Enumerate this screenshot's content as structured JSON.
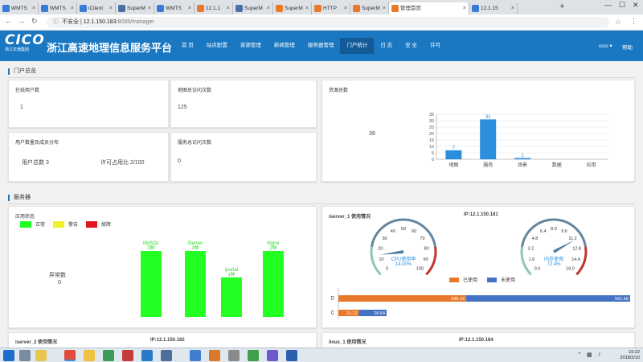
{
  "browser": {
    "tabs": [
      {
        "label": "WMTS",
        "active": false
      },
      {
        "label": "WMTS",
        "active": false
      },
      {
        "label": "iClient",
        "active": false
      },
      {
        "label": "SuperM",
        "active": false
      },
      {
        "label": "WMTS",
        "active": false
      },
      {
        "label": "12.1.1",
        "active": false
      },
      {
        "label": "SuperM",
        "active": false
      },
      {
        "label": "SuperM",
        "active": false
      },
      {
        "label": "HTTP",
        "active": false
      },
      {
        "label": "SuperM",
        "active": false
      },
      {
        "label": "管理首页",
        "active": true
      },
      {
        "label": "12.1.15",
        "active": false
      }
    ],
    "security_label": "不安全",
    "url_host": "12.1.150.183",
    "url_path": ":8095/manager"
  },
  "app": {
    "logo_text": "CICO",
    "logo_subtext": "浙江交通集团",
    "title": "浙江高速地理信息服务平台",
    "nav": [
      "首 页",
      "站点配置",
      "资源管理",
      "新闻管理",
      "服务器管理",
      "门户统计",
      "日 志",
      "安 全",
      "许可"
    ],
    "nav_active_index": 5,
    "user": "cico ▾",
    "help": "帮助"
  },
  "portal": {
    "section_title": "门户总览",
    "online_users": {
      "title": "在线用户数",
      "value": "1"
    },
    "map_visits": {
      "title": "地图总访问次数",
      "value": "125"
    },
    "user_dist": {
      "title": "用户数量及成员分布",
      "total": "用户总数 3",
      "license": "许可占用比 2/100"
    },
    "service_visits": {
      "title": "服务总访问次数",
      "value": "0"
    },
    "resources": {
      "title": "资源总数",
      "value": "39"
    }
  },
  "servers": {
    "section_title": "服务器",
    "app_status": {
      "title": "应用状态",
      "legend": [
        {
          "label": "正常",
          "color": "#22ff22"
        },
        {
          "label": "警告",
          "color": "#f2f22a"
        },
        {
          "label": "故障",
          "color": "#e0141e"
        }
      ],
      "abnormal_label": "异常数",
      "abnormal_value": "0"
    },
    "iserver1": {
      "title": "iserver_1 使用情况",
      "ip": "IP:12.1.150.181",
      "cpu_label": "CPU使用率",
      "cpu_pct": "14.00%",
      "mem_label": "内存使用",
      "mem_pct": "72.4%",
      "legend_used": "已使用",
      "legend_free": "未使用",
      "used_color": "#e8792a",
      "free_color": "#4472c4"
    },
    "iserver2": {
      "title": "iserver_2 使用情况",
      "ip": "IP:12.1.150.182"
    },
    "linux1": {
      "title": "linux_1 使用情况",
      "ip": "IP:12.1.150.184"
    }
  },
  "chart_data": [
    {
      "type": "bar",
      "title": "",
      "categories": [
        "地图",
        "服务",
        "场景",
        "数据",
        "应用"
      ],
      "values": [
        7,
        31,
        1,
        0,
        0
      ],
      "ylim": [
        0,
        35
      ],
      "yticks": [
        0,
        5,
        10,
        15,
        20,
        25,
        30,
        35
      ],
      "grid": true,
      "color": "#2b8fe0"
    },
    {
      "type": "bar",
      "title": "",
      "categories": [
        "MySQL",
        "iServer",
        "iportal",
        "Nginx"
      ],
      "values": [
        100,
        100,
        60,
        100
      ],
      "value_labels": [
        "2种",
        "2种",
        "1种",
        "2种"
      ],
      "color": "#22ff22"
    },
    {
      "type": "gauge",
      "label": "CPU使用率",
      "value": 14.0,
      "range": [
        0,
        100
      ],
      "ticks": [
        "0",
        "10",
        "20",
        "30",
        "40",
        "50",
        "60",
        "70",
        "80",
        "90",
        "100"
      ]
    },
    {
      "type": "gauge",
      "label": "内存使用",
      "value": 11.6,
      "range": [
        0,
        16
      ],
      "ticks": [
        "0.0",
        "1.6",
        "3.2",
        "4.8",
        "6.4",
        "8.0",
        "9.6",
        "11.2",
        "12.8",
        "14.4",
        "16.0"
      ]
    },
    {
      "type": "bar",
      "orientation": "horizontal",
      "categories": [
        "D",
        "C"
      ],
      "series": [
        {
          "name": "已使用",
          "values": [
            438.19,
            21.12
          ]
        },
        {
          "name": "未使用",
          "values": [
            561.68,
            28.54
          ]
        }
      ]
    }
  ],
  "taskbar": {
    "time": "15:22",
    "date": "2018/2/10"
  }
}
